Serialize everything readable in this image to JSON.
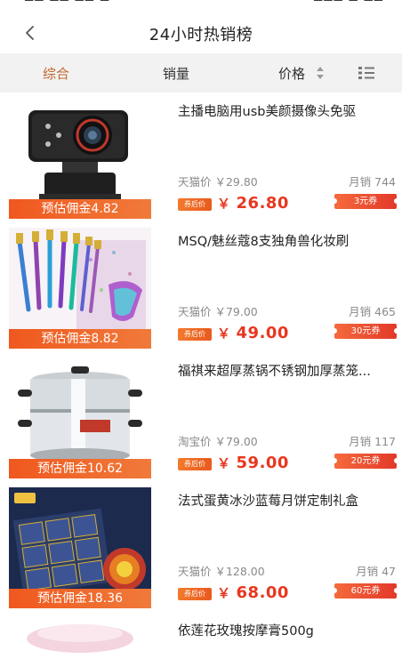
{
  "status": {
    "left": "▀▀ ▀▀ ▀▀ ▀",
    "right": "▀▀▀ ▀ ▀▀"
  },
  "header": {
    "title": "24小时热销榜"
  },
  "sort": {
    "comprehensive": "综合",
    "sales": "销量",
    "price": "价格"
  },
  "colors": {
    "accent": "#c0652a",
    "price": "#e8371f",
    "commission": "#f0581f",
    "coupon": "#e2392a"
  },
  "icons": {
    "back": "chevron-left-icon",
    "sort": "sort-arrows-icon",
    "layout": "list-layout-icon"
  },
  "products": [
    {
      "title": "主播电脑用usb美颜摄像头免驱",
      "commission": "预估佣金4.82",
      "orig_price": "天猫价 ￥29.80",
      "sales": "月销 744",
      "badge": "券后价",
      "currency": "￥",
      "price": "26.80",
      "coupon": "3元券",
      "image": "webcam"
    },
    {
      "title": "MSQ/魅丝蔻8支独角兽化妆刷",
      "commission": "预估佣金8.82",
      "orig_price": "天猫价 ￥79.00",
      "sales": "月销 465",
      "badge": "券后价",
      "currency": "￥",
      "price": "49.00",
      "coupon": "30元券",
      "image": "brushes"
    },
    {
      "title": "福祺来超厚蒸锅不锈钢加厚蒸笼...",
      "commission": "预估佣金10.62",
      "orig_price": "淘宝价 ￥79.00",
      "sales": "月销 117",
      "badge": "券后价",
      "currency": "￥",
      "price": "59.00",
      "coupon": "20元券",
      "image": "steamer"
    },
    {
      "title": "法式蛋黄冰沙蓝莓月饼定制礼盒",
      "commission": "预估佣金18.36",
      "orig_price": "天猫价 ￥128.00",
      "sales": "月销 47",
      "badge": "券后价",
      "currency": "￥",
      "price": "68.00",
      "coupon": "60元券",
      "image": "mooncake"
    },
    {
      "title": "依莲花玫瑰按摩膏500g",
      "image": "cream"
    }
  ]
}
